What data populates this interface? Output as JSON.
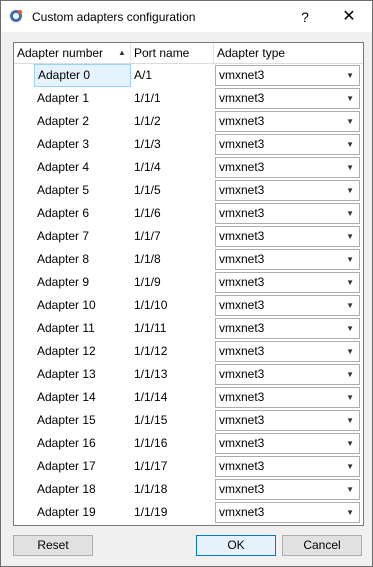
{
  "window": {
    "title": "Custom adapters configuration",
    "help_label": "?",
    "close_label": "✕",
    "icon": "app-logo-icon"
  },
  "table": {
    "headers": {
      "adapter_number": "Adapter number",
      "port_name": "Port name",
      "adapter_type": "Adapter type"
    },
    "sort": {
      "column": "adapter_number",
      "direction": "ascending",
      "icon": "sort-ascending-icon"
    },
    "selected_row": 0,
    "rows": [
      {
        "adapter": "Adapter 0",
        "port": "A/1",
        "type": "vmxnet3"
      },
      {
        "adapter": "Adapter 1",
        "port": "1/1/1",
        "type": "vmxnet3"
      },
      {
        "adapter": "Adapter 2",
        "port": "1/1/2",
        "type": "vmxnet3"
      },
      {
        "adapter": "Adapter 3",
        "port": "1/1/3",
        "type": "vmxnet3"
      },
      {
        "adapter": "Adapter 4",
        "port": "1/1/4",
        "type": "vmxnet3"
      },
      {
        "adapter": "Adapter 5",
        "port": "1/1/5",
        "type": "vmxnet3"
      },
      {
        "adapter": "Adapter 6",
        "port": "1/1/6",
        "type": "vmxnet3"
      },
      {
        "adapter": "Adapter 7",
        "port": "1/1/7",
        "type": "vmxnet3"
      },
      {
        "adapter": "Adapter 8",
        "port": "1/1/8",
        "type": "vmxnet3"
      },
      {
        "adapter": "Adapter 9",
        "port": "1/1/9",
        "type": "vmxnet3"
      },
      {
        "adapter": "Adapter 10",
        "port": "1/1/10",
        "type": "vmxnet3"
      },
      {
        "adapter": "Adapter 11",
        "port": "1/1/11",
        "type": "vmxnet3"
      },
      {
        "adapter": "Adapter 12",
        "port": "1/1/12",
        "type": "vmxnet3"
      },
      {
        "adapter": "Adapter 13",
        "port": "1/1/13",
        "type": "vmxnet3"
      },
      {
        "adapter": "Adapter 14",
        "port": "1/1/14",
        "type": "vmxnet3"
      },
      {
        "adapter": "Adapter 15",
        "port": "1/1/15",
        "type": "vmxnet3"
      },
      {
        "adapter": "Adapter 16",
        "port": "1/1/16",
        "type": "vmxnet3"
      },
      {
        "adapter": "Adapter 17",
        "port": "1/1/17",
        "type": "vmxnet3"
      },
      {
        "adapter": "Adapter 18",
        "port": "1/1/18",
        "type": "vmxnet3"
      },
      {
        "adapter": "Adapter 19",
        "port": "1/1/19",
        "type": "vmxnet3"
      }
    ]
  },
  "buttons": {
    "reset": "Reset",
    "ok": "OK",
    "cancel": "Cancel"
  },
  "colors": {
    "selection_bg": "#e5f3ff",
    "selection_border": "#99d1ff",
    "default_button_border": "#0078d7"
  }
}
